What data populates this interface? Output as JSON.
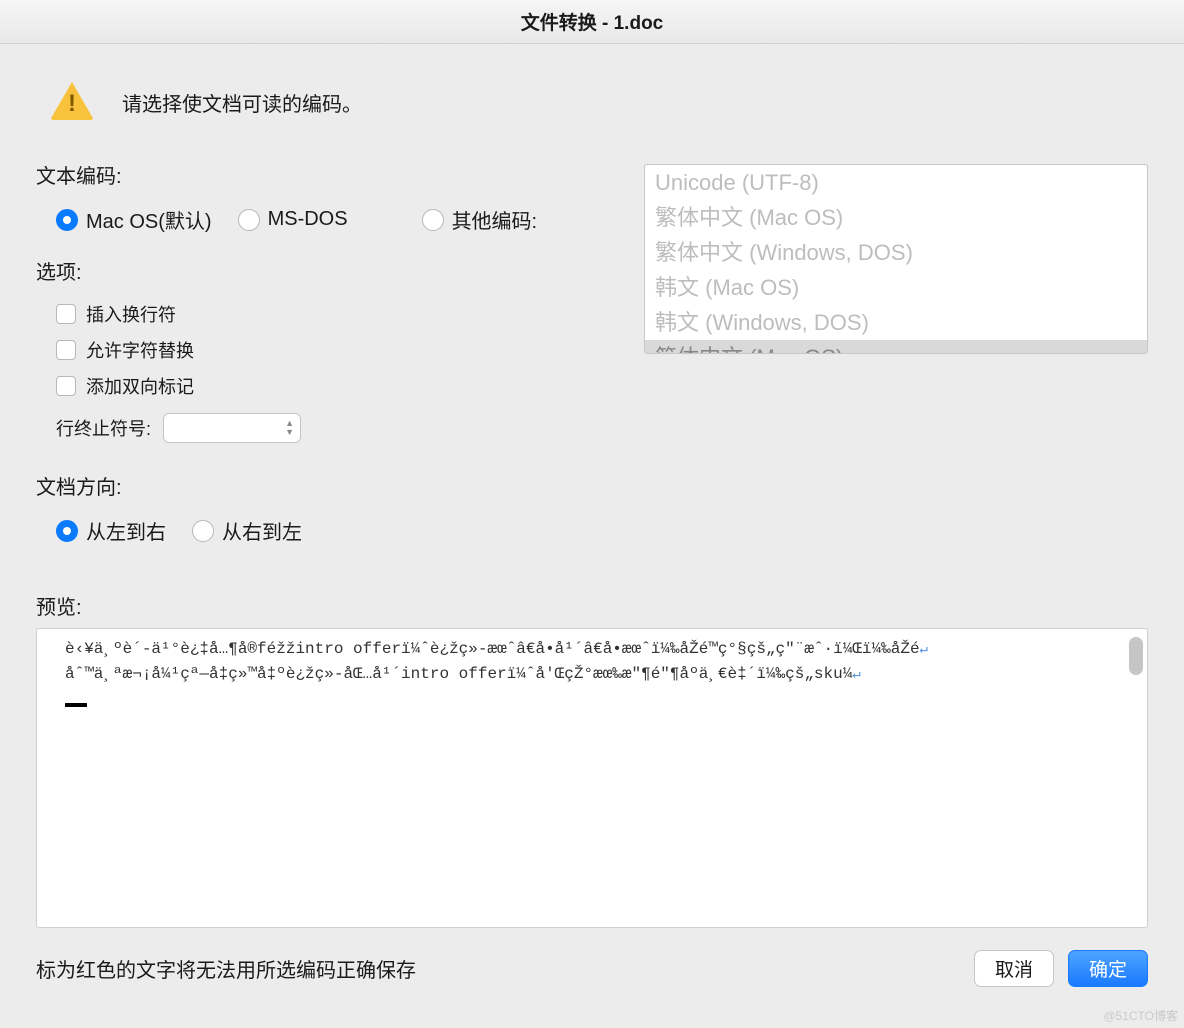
{
  "window": {
    "title": "文件转换 - 1.doc"
  },
  "alert": {
    "prompt": "请选择使文档可读的编码。"
  },
  "encoding": {
    "section_label": "文本编码:",
    "options": {
      "macos": "Mac OS(默认)",
      "msdos": "MS-DOS",
      "other": "其他编码:"
    },
    "selected": "macos",
    "list": [
      "Unicode (UTF-8)",
      "繁体中文 (Mac OS)",
      "繁体中文 (Windows, DOS)",
      "韩文 (Mac OS)",
      "韩文 (Windows, DOS)",
      "简体中文 (Mac OS)"
    ],
    "list_selected_index": 5
  },
  "options": {
    "section_label": "选项:",
    "insert_linebreaks": "插入换行符",
    "allow_char_sub": "允许字符替换",
    "add_bidi_marks": "添加双向标记",
    "line_terminator_label": "行终止符号:",
    "line_terminator_value": ""
  },
  "direction": {
    "section_label": "文档方向:",
    "ltr": "从左到右",
    "rtl": "从右到左",
    "selected": "ltr"
  },
  "preview": {
    "label": "预览:",
    "lines": [
      "è‹¥ä¸ºè´-ä¹°è¿‡å…¶å®féžžintro offerï¼ˆè¿žç»-æœˆâ€å•å¹´â€å•æœˆï¼‰åŽé™ç°§çš„ç\"¨æˆ·ï¼Œï¼‰åŽé",
      "åˆ™ä¸ªæ¬¡å¼¹çª—å‡ç»™å‡ºè¿žç»-åŒ…å¹´intro offerï¼ˆå'ŒçŽ°æœ‰æ\"¶é\"¶åºä¸€è‡´ï¼‰çš„sku¼"
    ]
  },
  "footer": {
    "note": "标为红色的文字将无法用所选编码正确保存",
    "cancel": "取消",
    "ok": "确定"
  },
  "watermark": "@51CTO博客"
}
